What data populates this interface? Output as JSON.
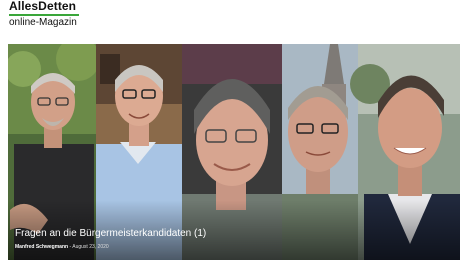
{
  "site": {
    "logo_line1": "AllesDetten",
    "logo_line2": "online-Magazin",
    "accent_color": "#3aa63a"
  },
  "featured": {
    "title": "Fragen an die Bürgermeisterkandidaten (1)",
    "author": "Manfred Schwegmann",
    "separator": " - ",
    "date": "August 23, 2020"
  }
}
